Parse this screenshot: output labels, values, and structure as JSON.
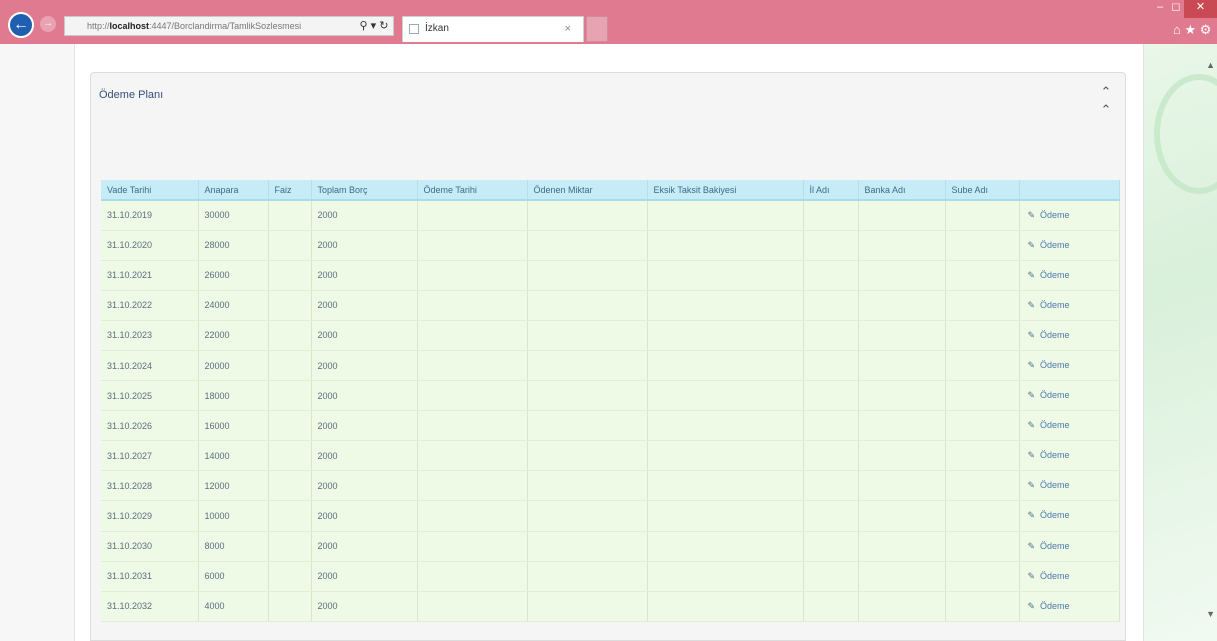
{
  "browser": {
    "url_prefix": "http://",
    "url_host": "localhost",
    "url_path": ":4447/Borclandirma/TamlikSozlesmesi",
    "search_icon": "search-icon",
    "refresh_icon": "refresh-icon",
    "tab_title": "İzkan",
    "tab_close": "×"
  },
  "panel": {
    "title": "Ödeme Planı",
    "collapse_glyph": "⌃"
  },
  "table": {
    "columns": [
      "Vade Tarihi",
      "Anapara",
      "Faiz",
      "Toplam Borç",
      "Ödeme Tarihi",
      "Ödenen Miktar",
      "Eksik Taksit Bakiyesi",
      "İl Adı",
      "Banka Adı",
      "Sube Adı",
      ""
    ],
    "action_label": "Ödeme",
    "rows": [
      {
        "vade": "31.10.2019",
        "anapara": "30000",
        "toplam": "2000"
      },
      {
        "vade": "31.10.2020",
        "anapara": "28000",
        "toplam": "2000"
      },
      {
        "vade": "31.10.2021",
        "anapara": "26000",
        "toplam": "2000"
      },
      {
        "vade": "31.10.2022",
        "anapara": "24000",
        "toplam": "2000"
      },
      {
        "vade": "31.10.2023",
        "anapara": "22000",
        "toplam": "2000"
      },
      {
        "vade": "31.10.2024",
        "anapara": "20000",
        "toplam": "2000"
      },
      {
        "vade": "31.10.2025",
        "anapara": "18000",
        "toplam": "2000"
      },
      {
        "vade": "31.10.2026",
        "anapara": "16000",
        "toplam": "2000"
      },
      {
        "vade": "31.10.2027",
        "anapara": "14000",
        "toplam": "2000"
      },
      {
        "vade": "31.10.2028",
        "anapara": "12000",
        "toplam": "2000"
      },
      {
        "vade": "31.10.2029",
        "anapara": "10000",
        "toplam": "2000"
      },
      {
        "vade": "31.10.2030",
        "anapara": "8000",
        "toplam": "2000"
      },
      {
        "vade": "31.10.2031",
        "anapara": "6000",
        "toplam": "2000"
      },
      {
        "vade": "31.10.2032",
        "anapara": "4000",
        "toplam": "2000"
      }
    ]
  },
  "colors": {
    "chrome": "#e07a90",
    "header_bg": "#c6ecf7",
    "row_bg": "#eef9e6"
  }
}
